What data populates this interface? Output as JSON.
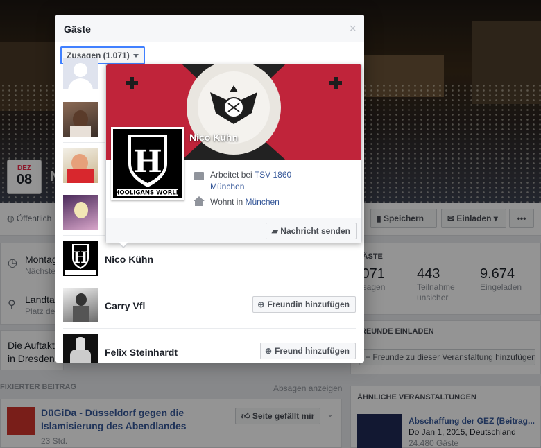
{
  "event": {
    "date_month": "DEZ",
    "date_day": "08",
    "title_partial": "N",
    "privacy": "Öffentlich",
    "actions": {
      "save": "Speichern",
      "invite": "Einladen",
      "more": "•••"
    },
    "time_label": "Montag",
    "time_sub": "Nächste",
    "location_label": "Landtag",
    "location_sub": "Platz de",
    "desc_line1": "Die Auftakt",
    "desc_line2": "in Dresden",
    "pinned_label": "FIXIERTER BEITRAG",
    "show_declines": "Absagen anzeigen",
    "pinned_post": {
      "title": "DüGiDa - Düsseldorf gegen die Islamisierung des Abendlandes",
      "title_line1": "DüGiDa - Düsseldorf gegen die",
      "title_line2": "Islamisierung des Abendlandes",
      "time": "23 Std.",
      "like_button": "Seite gefällt mir"
    },
    "guests_header": "GÄSTE",
    "stats": [
      {
        "num": ".071",
        "label": "usagen"
      },
      {
        "num": "443",
        "label": "Teilnahme unsicher",
        "l1": "Teilnahme",
        "l2": "unsicher"
      },
      {
        "num": "9.674",
        "label": "Eingeladen"
      }
    ],
    "invite_friends_header": "REUNDE EINLADEN",
    "invite_friends_button": "Freunde zu dieser Veranstaltung hinzufügen",
    "similar_header": "ÄHNLICHE VERANSTALTUNGEN",
    "similar": {
      "title": "Abschaffung der GEZ (Beitrag...",
      "date": "Do Jan 1, 2015, Deutschland",
      "guests": "24.480 Gäste"
    }
  },
  "dialog": {
    "title": "Gäste",
    "close": "×",
    "filter": "Zusagen (1.071)",
    "guests": [
      {
        "name": "",
        "button": ""
      },
      {
        "name": "",
        "button": ""
      },
      {
        "name": "",
        "button": ""
      },
      {
        "name": "",
        "button": ""
      },
      {
        "name": "Nico Kühn",
        "button": ""
      },
      {
        "name": "Carry Vfl",
        "button": "Freundin hinzufügen"
      },
      {
        "name": "Felix Steinhardt",
        "button": "Freund hinzufügen"
      }
    ]
  },
  "hovercard": {
    "name": "Nico Kühn",
    "work_prefix": "Arbeitet bei ",
    "work_link1": "TSV 1860",
    "work_link2": "München",
    "home_prefix": "Wohnt in ",
    "home_link": "München",
    "message_button": "Nachricht senden",
    "logo_text": "HOOLIGANS WORLD",
    "logo_letter": "H"
  },
  "colors": {
    "link": "#365899",
    "focus": "#4080ff",
    "flag_red": "#c0243a"
  }
}
